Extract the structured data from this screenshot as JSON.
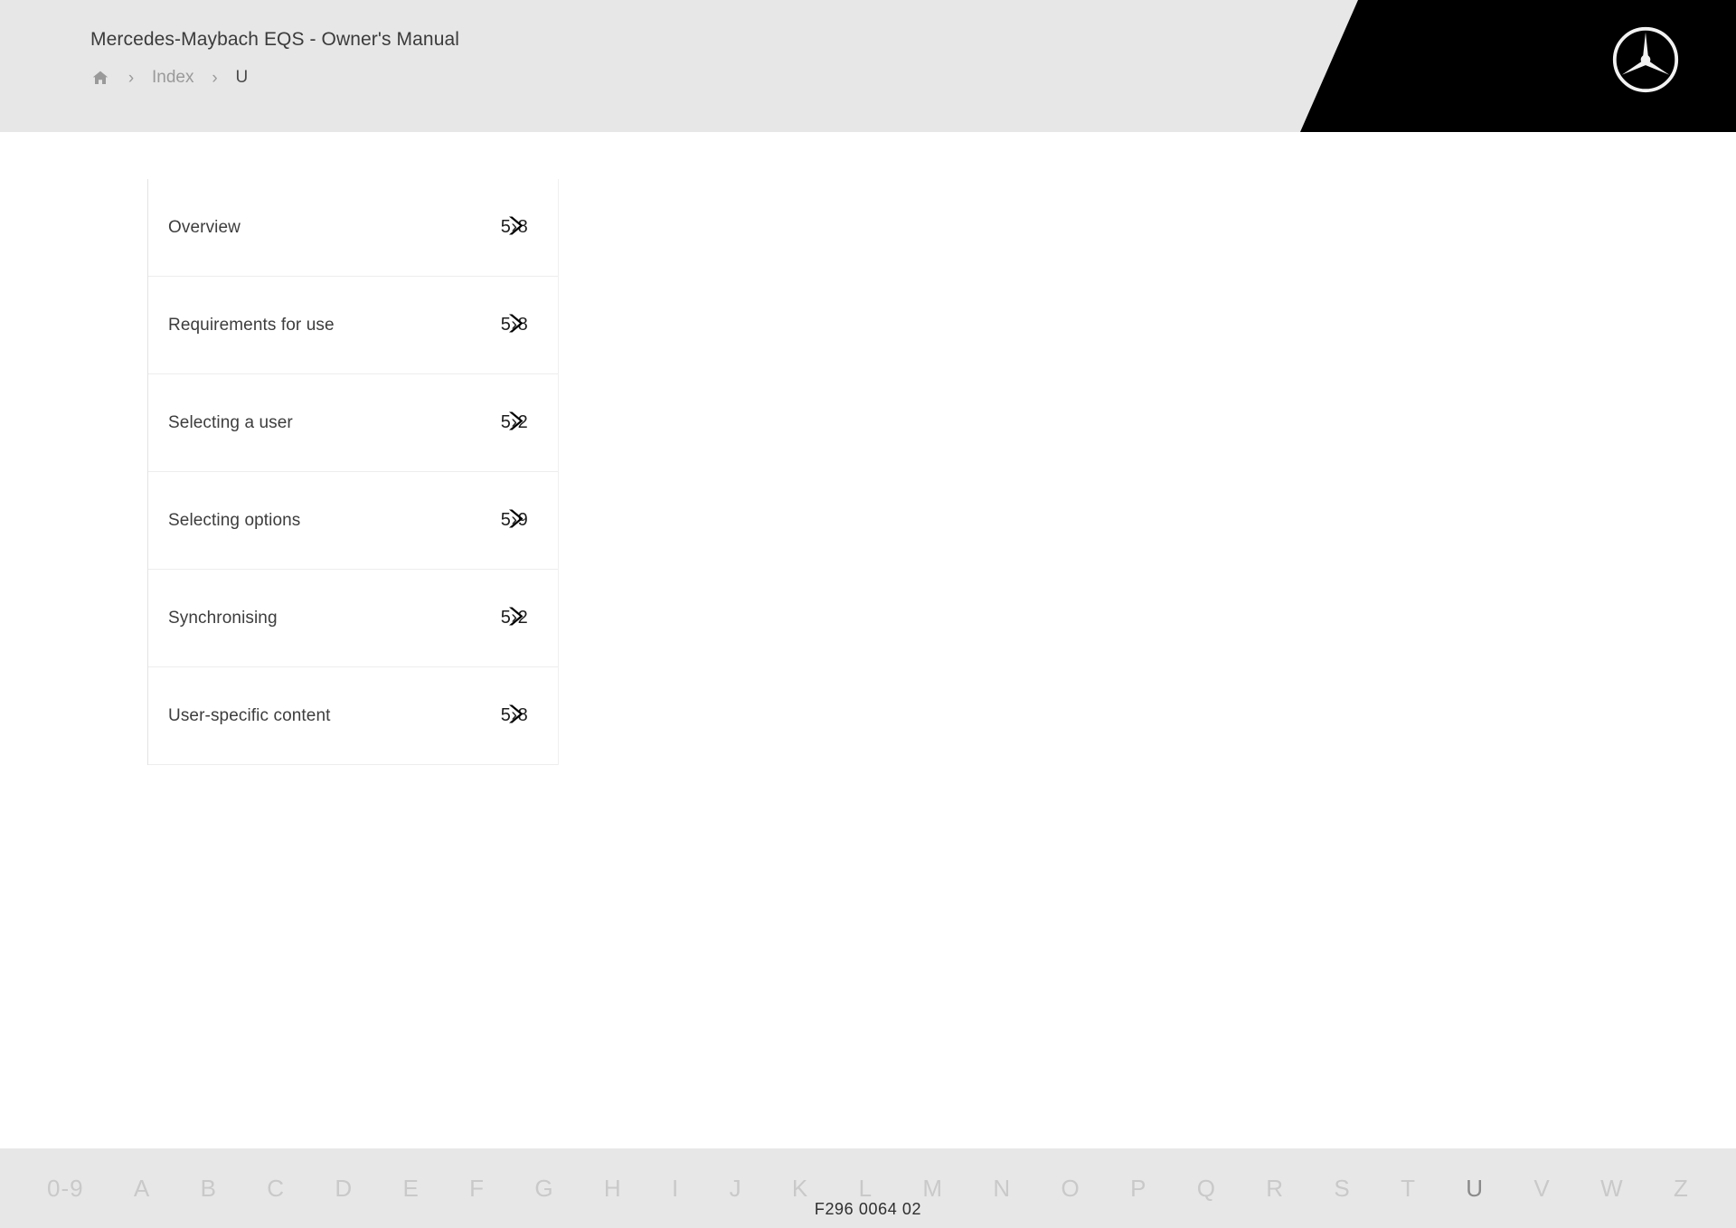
{
  "header": {
    "app_title": "Mercedes-Maybach EQS - Owner's Manual",
    "breadcrumb": {
      "home_icon": "home-icon",
      "separator": "›",
      "items": [
        {
          "label": "Index",
          "current": false
        },
        {
          "label": "U",
          "current": true
        }
      ]
    },
    "brand_logo": "mercedes-star-icon",
    "background_color": "#e7e7e7",
    "accent_block_color": "#000000"
  },
  "index_list": {
    "rows": [
      {
        "label": "Overview",
        "page": "5›8",
        "chevron": "chevron-right-icon"
      },
      {
        "label": "Requirements for use",
        "page": "5›8",
        "chevron": "chevron-right-icon"
      },
      {
        "label": "Selecting a user",
        "page": "5›2",
        "chevron": "chevron-right-icon"
      },
      {
        "label": "Selecting options",
        "page": "5›9",
        "chevron": "chevron-right-icon"
      },
      {
        "label": "Synchronising",
        "page": "5›2",
        "chevron": "chevron-right-icon"
      },
      {
        "label": "User-specific content",
        "page": "5›8",
        "chevron": "chevron-right-icon"
      }
    ]
  },
  "alphabet_bar": {
    "items": [
      {
        "label": "0-9",
        "active": false
      },
      {
        "label": "A",
        "active": false
      },
      {
        "label": "B",
        "active": false
      },
      {
        "label": "C",
        "active": false
      },
      {
        "label": "D",
        "active": false
      },
      {
        "label": "E",
        "active": false
      },
      {
        "label": "F",
        "active": false
      },
      {
        "label": "G",
        "active": false
      },
      {
        "label": "H",
        "active": false
      },
      {
        "label": "I",
        "active": false
      },
      {
        "label": "J",
        "active": false
      },
      {
        "label": "K",
        "active": false
      },
      {
        "label": "L",
        "active": false
      },
      {
        "label": "M",
        "active": false
      },
      {
        "label": "N",
        "active": false
      },
      {
        "label": "O",
        "active": false
      },
      {
        "label": "P",
        "active": false
      },
      {
        "label": "Q",
        "active": false
      },
      {
        "label": "R",
        "active": false
      },
      {
        "label": "S",
        "active": false
      },
      {
        "label": "T",
        "active": false
      },
      {
        "label": "U",
        "active": true
      },
      {
        "label": "V",
        "active": false
      },
      {
        "label": "W",
        "active": false
      },
      {
        "label": "Z",
        "active": false
      }
    ]
  },
  "footer": {
    "document_code": "F296 0064 02"
  }
}
